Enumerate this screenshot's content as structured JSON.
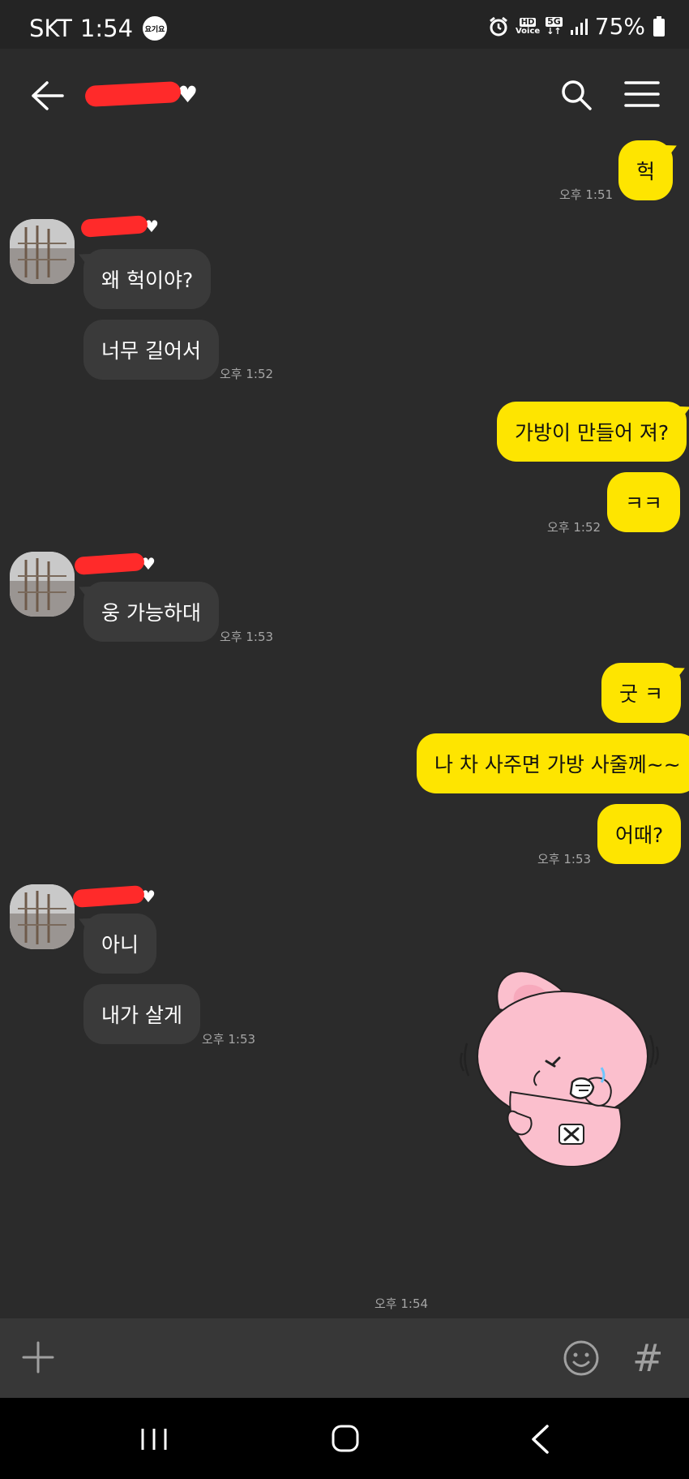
{
  "status_bar": {
    "carrier": "SKT",
    "time": "1:54",
    "app_badge": "요기요",
    "hd_line1": "HD",
    "hd_line2": "Voice",
    "network": "5G",
    "battery": "75%"
  },
  "header": {
    "title_icon": "heart-icon",
    "search_icon": "search-icon",
    "menu_icon": "menu-icon",
    "back_icon": "back-arrow-icon"
  },
  "messages": [
    {
      "from": "me",
      "text": "헉",
      "time": "오후 1:51"
    },
    {
      "from": "other",
      "text": "왜 헉이야?"
    },
    {
      "from": "other",
      "text": "너무 길어서",
      "time": "오후 1:52"
    },
    {
      "from": "me",
      "text": "가방이 만들어 져?"
    },
    {
      "from": "me",
      "text": "ㅋㅋ",
      "time": "오후 1:52"
    },
    {
      "from": "other",
      "text": "웅 가능하대",
      "time": "오후 1:53"
    },
    {
      "from": "me",
      "text": "굿 ㅋ"
    },
    {
      "from": "me",
      "text": "나 차 사주면 가방 사줄께~~"
    },
    {
      "from": "me",
      "text": "어때?",
      "time": "오후 1:53"
    },
    {
      "from": "other",
      "text": "아니"
    },
    {
      "from": "other",
      "text": "내가 살게",
      "time": "오후 1:53"
    },
    {
      "from": "me",
      "type": "sticker",
      "sticker": "pink-bunny-crying-sticker",
      "time": "오후 1:54"
    }
  ],
  "input_bar": {
    "plus_icon": "plus-icon",
    "emoji_icon": "emoji-icon",
    "hash_label": "#"
  },
  "colors": {
    "background": "#2b2b2b",
    "my_bubble": "#fee500",
    "other_bubble": "#3a3a3a",
    "redaction": "#ff2a2a"
  }
}
